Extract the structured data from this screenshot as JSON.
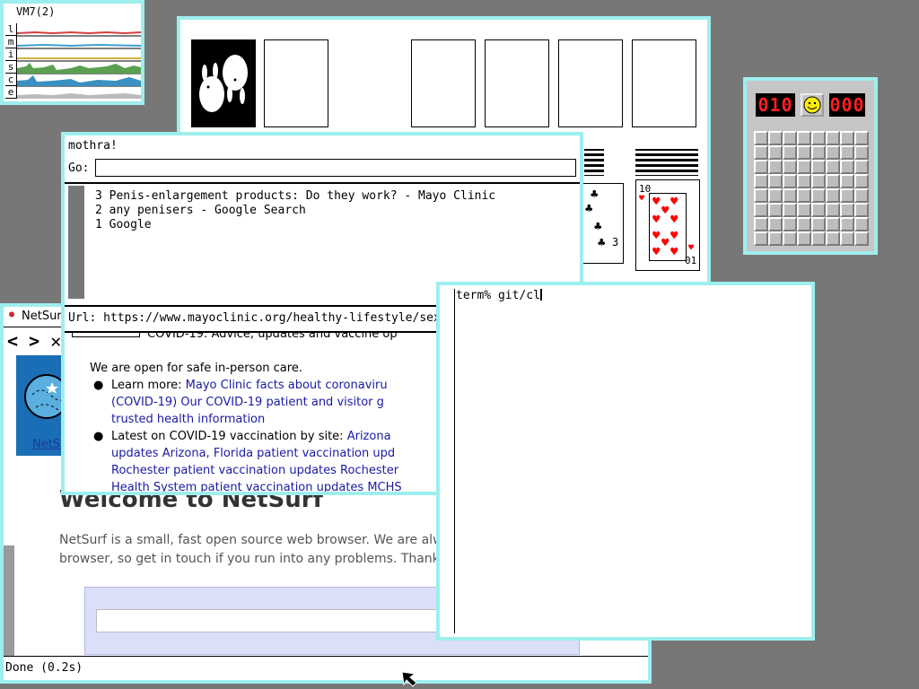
{
  "stats": {
    "title": "VM7(2)",
    "letters": [
      "l",
      "m",
      "i",
      "s",
      "c",
      "e"
    ]
  },
  "mothra": {
    "title": "mothra!",
    "go_label": "Go:",
    "go_value": "",
    "history": [
      "3 Penis-enlargement products: Do they work? - Mayo Clinic",
      "2 any penisers - Google Search",
      "1 Google"
    ],
    "url": "Url: https://www.mayoclinic.org/healthy-lifestyle/sex",
    "content": {
      "cut_heading": "COVID-19: Advice, updates and vaccine op",
      "open_text": "We are open for safe in-person care.",
      "bullet1_label": "Learn more:",
      "bullet1_link1": "Mayo Clinic facts about coronaviru",
      "bullet1_link2": "(COVID-19) Our COVID-19 patient and visitor g",
      "bullet1_link3": "trusted health information",
      "bullet2_label": "Latest on COVID-19 vaccination by site:",
      "bullet2_link1": "Arizona",
      "bullet2_link2": "updates Arizona,",
      "bullet2_link3": "Florida patient vaccination upd",
      "bullet2_link4": "Rochester patient vaccination updates Rochester",
      "bullet2_link5": "Health System patient vaccination updates MCHS"
    }
  },
  "netsurf": {
    "title": "NetSurf",
    "nav_back": "<",
    "nav_forward": ">",
    "nav_stop": "✕",
    "tab_label": "NetSu",
    "heading": "Welcome to NetSurf",
    "para_line1": "NetSurf is a small, fast open source web browser. We are alw",
    "para_line2": "browser, so get in touch if you run into any problems. Thank",
    "status": "Done (0.2s)"
  },
  "solitaire": {
    "card1_rank": "3",
    "card2_rank": "10",
    "card2_rank_bottom": "01"
  },
  "minesweeper": {
    "mines_left": "010",
    "timer": "000"
  },
  "terminal": {
    "prompt": "term% git/cl"
  },
  "colors": {
    "border": "#9eeeee",
    "desktop": "#777777",
    "link": "#1a1aa6",
    "heart": "#ff0000"
  }
}
